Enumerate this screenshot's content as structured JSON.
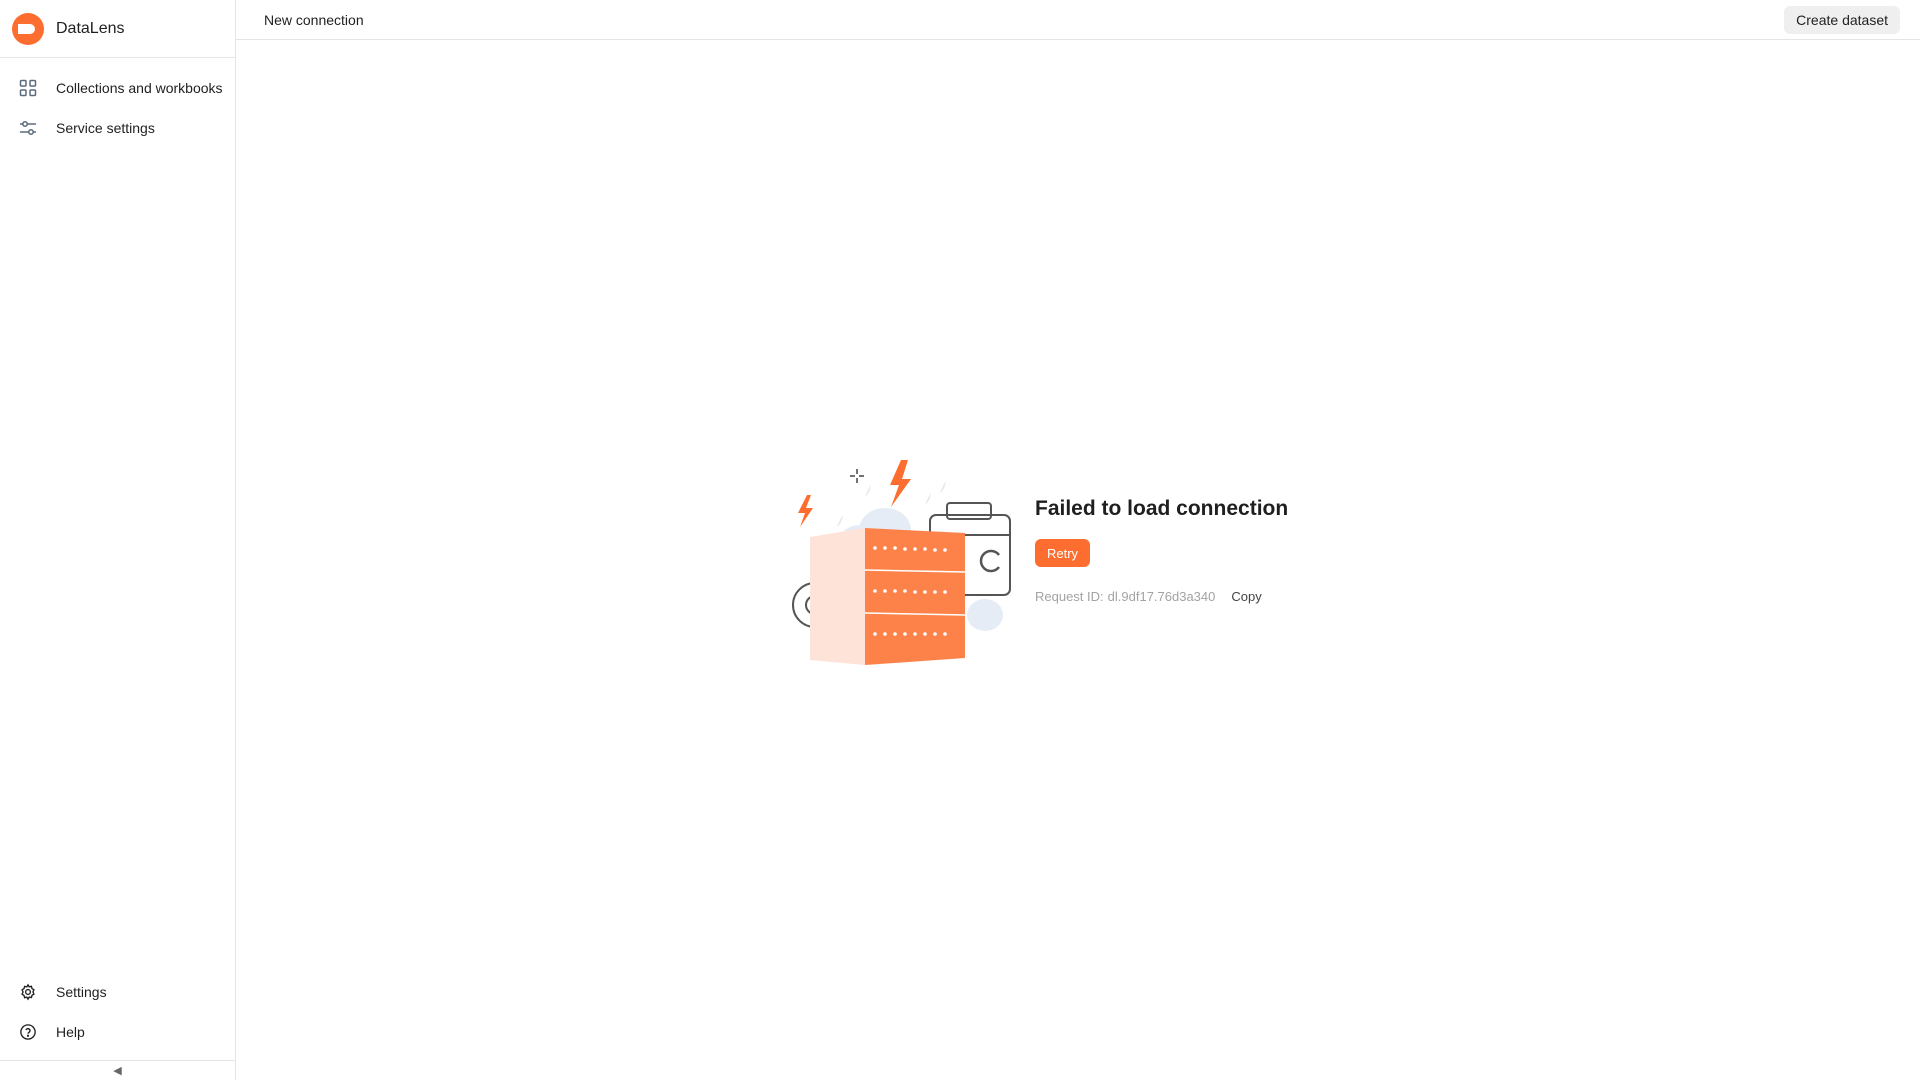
{
  "app": {
    "name": "DataLens",
    "brand_color": "#fd6d2f"
  },
  "sidebar": {
    "items": [
      {
        "label": "Collections and workbooks",
        "icon": "grid-icon"
      },
      {
        "label": "Service settings",
        "icon": "sliders-icon"
      }
    ],
    "bottom_items": [
      {
        "label": "Settings",
        "icon": "gear-icon"
      },
      {
        "label": "Help",
        "icon": "help-circle-icon"
      }
    ],
    "collapse_icon": "◀"
  },
  "header": {
    "title": "New connection",
    "create_dataset_label": "Create dataset"
  },
  "error": {
    "title": "Failed to load connection",
    "retry_label": "Retry",
    "request_label": "Request ID:",
    "request_id": "dl.9df17.76d3a340",
    "copy_label": "Copy"
  }
}
